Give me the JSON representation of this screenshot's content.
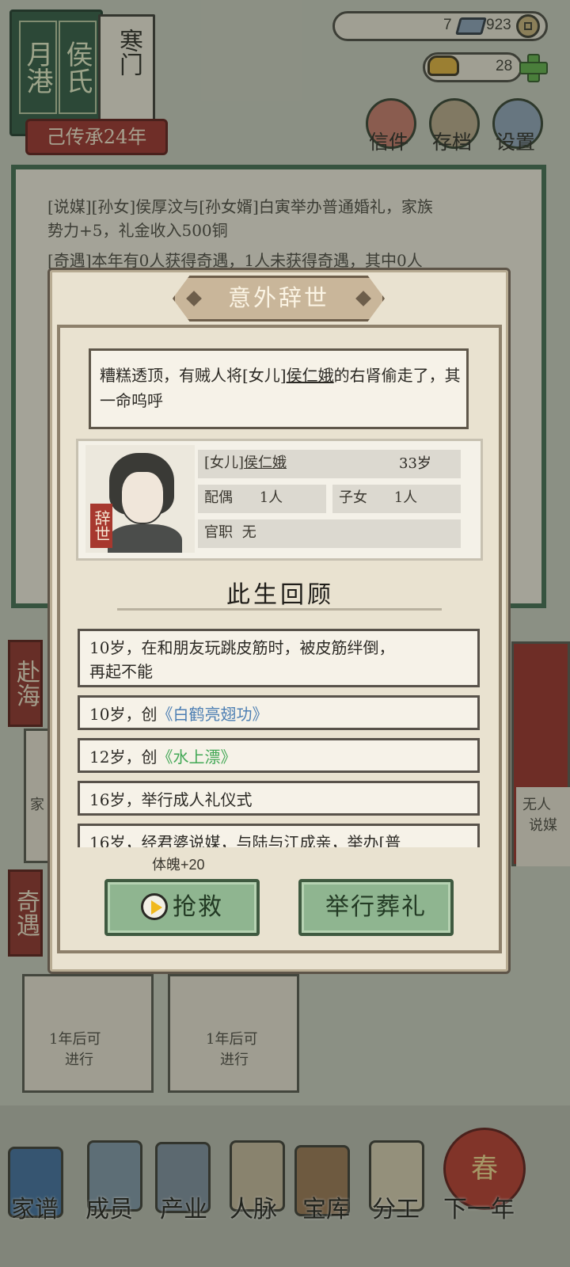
{
  "header": {
    "family_name_left": "月港",
    "family_name_right": "侯氏",
    "family_rank": "寒门",
    "heritage": "己传承24年"
  },
  "currency": {
    "silver_count": "7",
    "copper_count": "923",
    "gold_count": "28"
  },
  "top_actions": {
    "letters": "信件",
    "archive": "存档",
    "settings": "设置"
  },
  "log": {
    "lines": [
      "[说媒][孙女]侯厚汶与[孙女婿]白寅举办普通婚礼，家族",
      "势力+5，礼金收入500铜",
      "[奇遇]本年有0人获得奇遇，1人未获得奇遇，其中0人"
    ]
  },
  "side": {
    "sea_tag": "赴海",
    "encounter_tag": "奇遇",
    "left_tile_text": "家",
    "right_tile_line1": "无人",
    "right_tile_line2": "说媒",
    "tile1_line1": "1年后可",
    "tile1_line2": "进行",
    "tile2_line1": "1年后可",
    "tile2_line2": "进行"
  },
  "modal": {
    "title": "意外辞世",
    "message_part1": "糟糕透顶，有贼人将[女儿]",
    "message_name": "侯仁娥",
    "message_part2": "的右肾偷走了，其一命呜呼",
    "death_seal": "辞世",
    "person": {
      "role": "[女儿]",
      "name": "侯仁娥",
      "age": "33岁",
      "spouse_label": "配偶",
      "spouse_value": "1人",
      "children_label": "子女",
      "children_value": "1人",
      "office_label": "官职",
      "office_value": "无"
    },
    "review_title": "此生回顾",
    "review_items": [
      {
        "line1": "10岁，在和朋友玩跳皮筋时，被皮筋绊倒，",
        "line2": "再起不能"
      },
      {
        "prefix": "10岁，创",
        "kungfu": "《白鹤亮翅功》"
      },
      {
        "prefix": "12岁，创",
        "kungfu": "《水上漂》"
      },
      {
        "text": "16岁，举行成人礼仪式"
      },
      {
        "text": "16岁，经君婆说媒，与陆与江成亲，举办[普"
      }
    ],
    "effect": "体魄+20",
    "rescue_button": "抢救",
    "funeral_button": "举行葬礼"
  },
  "bottom_nav": {
    "items": [
      "家谱",
      "成员",
      "产业",
      "人脉",
      "宝库",
      "分工",
      "下一年"
    ],
    "spring": "春"
  },
  "colors": {
    "accent_green": "#8fb590",
    "seal_red": "#a7382e",
    "blue_kungfu": "#4d7fb3",
    "green_kungfu": "#43a856"
  }
}
